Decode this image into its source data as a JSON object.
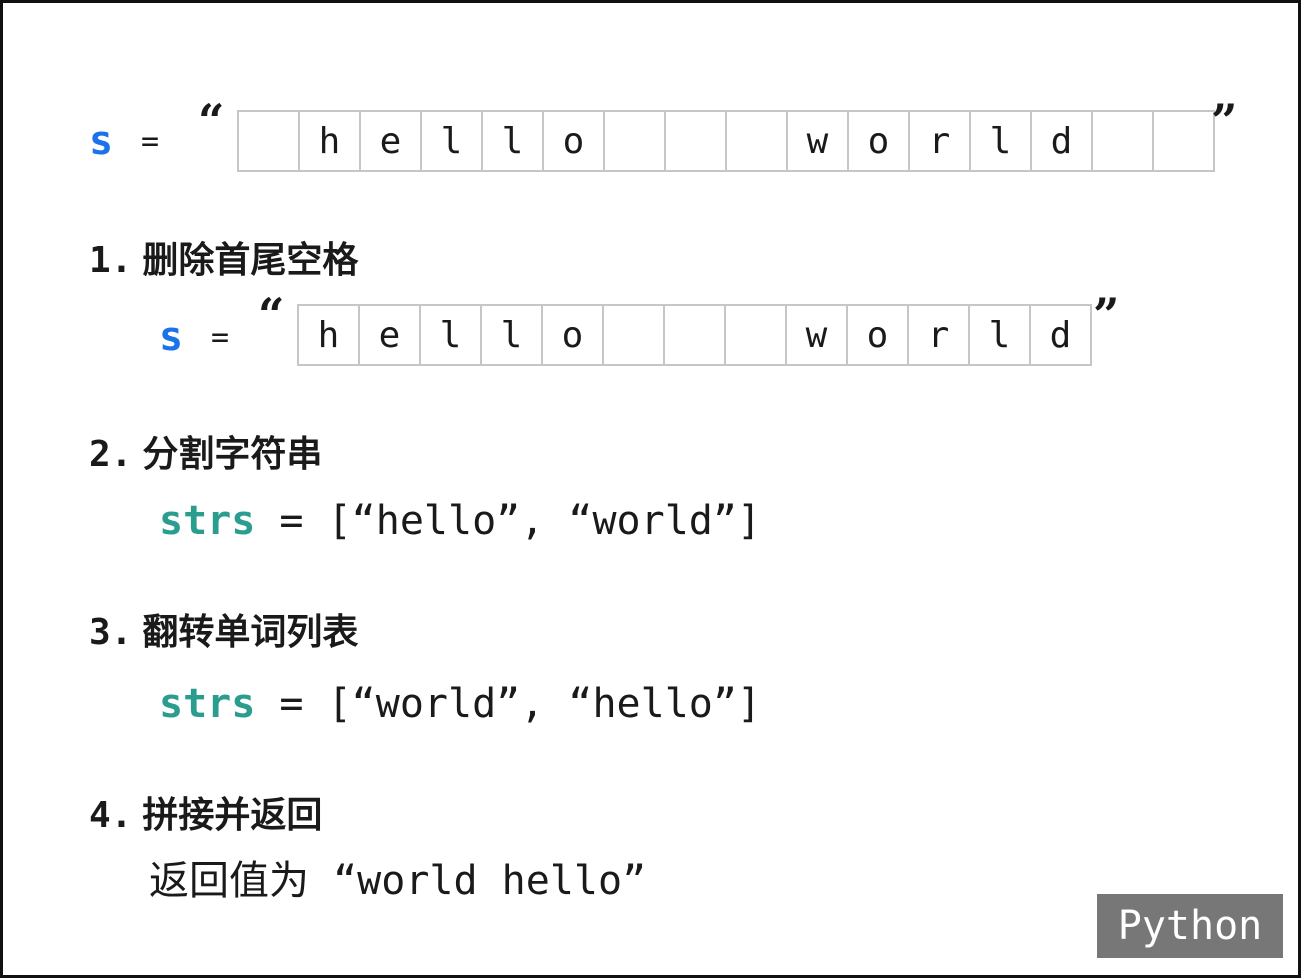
{
  "original": {
    "var": "s",
    "eq": "=",
    "open_quote": "“",
    "close_quote": "”",
    "cells": [
      "",
      "h",
      "e",
      "l",
      "l",
      "o",
      "",
      "",
      "",
      "w",
      "o",
      "r",
      "l",
      "d",
      "",
      ""
    ]
  },
  "steps": [
    {
      "num": "1.",
      "title": "删除首尾空格"
    },
    {
      "num": "2.",
      "title": "分割字符串"
    },
    {
      "num": "3.",
      "title": "翻转单词列表"
    },
    {
      "num": "4.",
      "title": "拼接并返回"
    }
  ],
  "trimmed": {
    "var": "s",
    "eq": "=",
    "open_quote": "“",
    "close_quote": "”",
    "cells": [
      "h",
      "e",
      "l",
      "l",
      "o",
      "",
      "",
      "",
      "w",
      "o",
      "r",
      "l",
      "d"
    ]
  },
  "split": {
    "var": "strs",
    "rest": " = [“hello”, “world”]"
  },
  "reversed": {
    "var": "strs",
    "rest": " = [“world”, “hello”]"
  },
  "result": {
    "text": "返回值为 “world hello”"
  },
  "badge": {
    "language": "Python"
  },
  "colors": {
    "var_s": "#1a73e8",
    "var_strs": "#2a9d8f",
    "cell_border": "#c6c6c6",
    "badge_bg": "#777777"
  }
}
